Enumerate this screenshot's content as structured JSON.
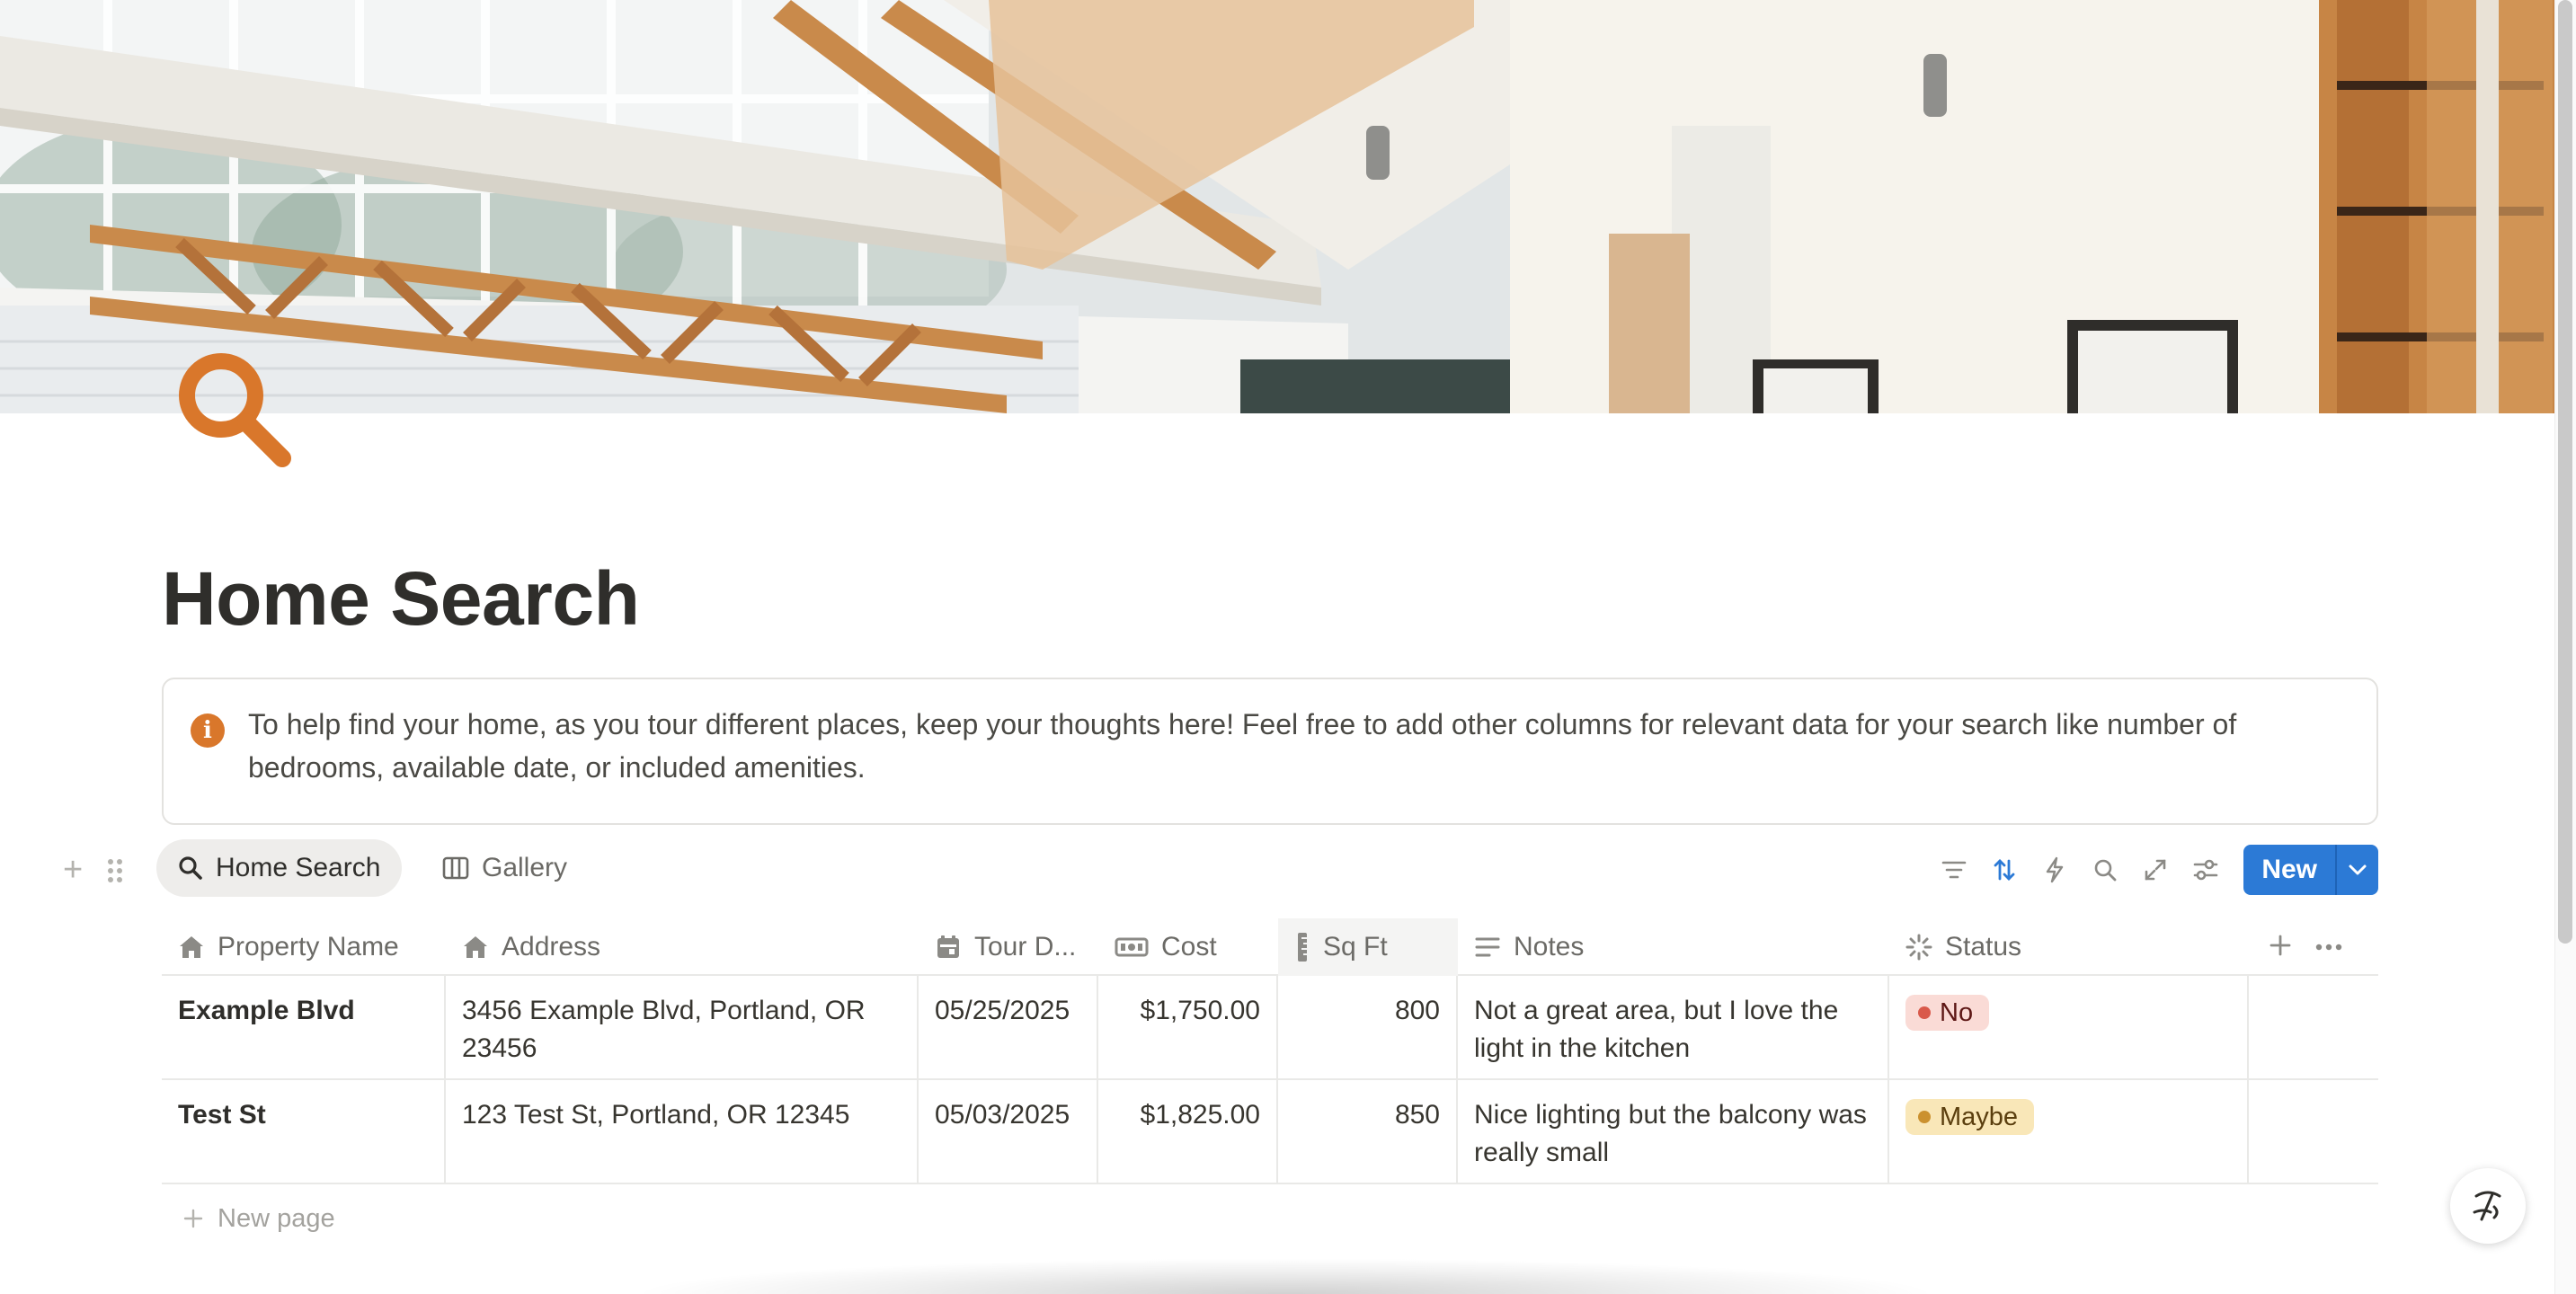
{
  "page": {
    "title": "Home Search",
    "callout": "To help find your home, as you tour different places, keep your thoughts here! Feel free to add other columns for relevant data for your search like number of bedrooms, available date, or included amenities."
  },
  "views": {
    "tabs": [
      {
        "label": "Home Search",
        "icon": "search-icon",
        "active": true
      },
      {
        "label": "Gallery",
        "icon": "gallery-icon",
        "active": false
      }
    ],
    "new_label": "New"
  },
  "table": {
    "columns": [
      {
        "label": "Property Name",
        "icon": "home-icon"
      },
      {
        "label": "Address",
        "icon": "home-icon"
      },
      {
        "label": "Tour D...",
        "icon": "calendar-icon"
      },
      {
        "label": "Cost",
        "icon": "money-icon"
      },
      {
        "label": "Sq Ft",
        "icon": "ruler-icon"
      },
      {
        "label": "Notes",
        "icon": "text-icon"
      },
      {
        "label": "Status",
        "icon": "status-icon"
      }
    ],
    "rows": [
      {
        "name": "Example Blvd",
        "address": "3456 Example Blvd, Portland, OR 23456",
        "tour_date": "05/25/2025",
        "cost": "$1,750.00",
        "sqft": "800",
        "notes": "Not a great area, but I love the light in the kitchen",
        "status": "No"
      },
      {
        "name": "Test St",
        "address": "123 Test St, Portland, OR 12345",
        "tour_date": "05/03/2025",
        "cost": "$1,825.00",
        "sqft": "850",
        "notes": "Nice lighting but the balcony was really small",
        "status": "Maybe"
      }
    ],
    "new_page_label": "New page"
  },
  "colors": {
    "accent_orange": "#d9772b",
    "new_button_blue": "#2c7ad6",
    "status_no_bg": "#fadbd6",
    "status_no_dot": "#d9594a",
    "status_maybe_bg": "#f9e7b8",
    "status_maybe_dot": "#cb912f"
  }
}
